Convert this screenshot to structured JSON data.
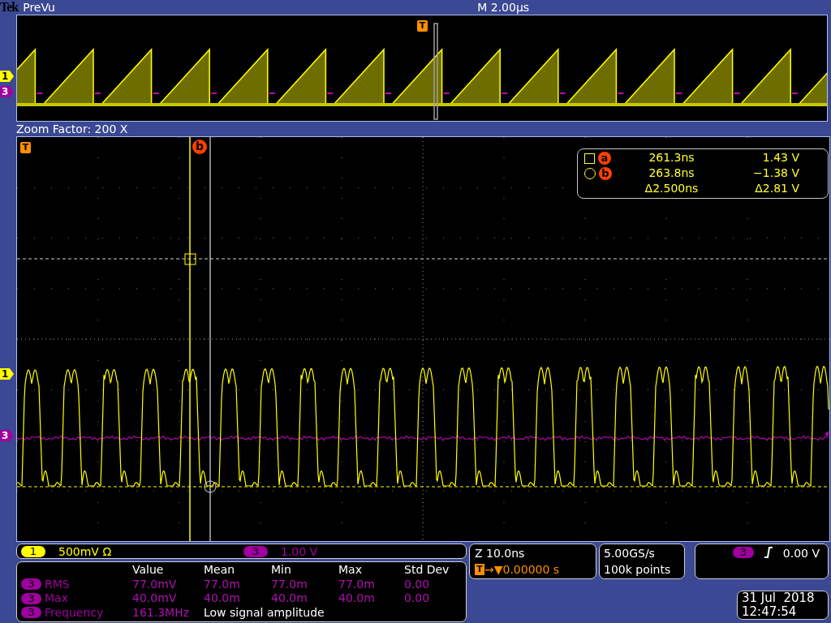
{
  "header": {
    "brand": "Tek",
    "mode": "PreVu",
    "timebase": "M 2.00µs"
  },
  "overview": {
    "trigger_marker": "T",
    "channel_markers": [
      {
        "label": "1",
        "color": "#ffff00"
      },
      {
        "label": "3",
        "color": "#a000a0"
      }
    ]
  },
  "zoom_bar": {
    "label": "Zoom Factor: 200 X"
  },
  "main": {
    "trigger_marker": "T",
    "cursor_marker": "b",
    "channel_markers": [
      {
        "label": "1",
        "color": "#ffff00"
      },
      {
        "label": "3",
        "color": "#a000a0"
      }
    ],
    "cursor_readout": [
      {
        "kind": "square",
        "cursor": "a",
        "time": "261.3ns",
        "volts": "1.43 V"
      },
      {
        "kind": "circle",
        "cursor": "b",
        "time": "263.8ns",
        "volts": "−1.38 V"
      },
      {
        "kind": "delta",
        "time": "Δ2.500ns",
        "volts": "Δ2.81 V"
      }
    ]
  },
  "channel_settings": [
    {
      "channel": "1",
      "scale": "500mV Ω",
      "color": "#ffff00"
    },
    {
      "channel": "3",
      "scale": "1.00 V",
      "color": "#a000a0"
    }
  ],
  "measurements": {
    "columns": [
      "Value",
      "Mean",
      "Min",
      "Max",
      "Std Dev"
    ],
    "rows": [
      {
        "channel": "3",
        "name": "RMS",
        "cells": [
          "77.0mV",
          "77.0m",
          "77.0m",
          "77.0m",
          "0.00"
        ]
      },
      {
        "channel": "3",
        "name": "Max",
        "cells": [
          "40.0mV",
          "40.0m",
          "40.0m",
          "40.0m",
          "0.00"
        ]
      },
      {
        "channel": "3",
        "name": "Frequency",
        "cells": [
          "161.3MHz"
        ],
        "note": "Low signal amplitude"
      }
    ]
  },
  "horizontal": {
    "zoom": "Z 10.0ns",
    "trigger_icon": "T",
    "position": "→▼0.00000 s"
  },
  "acquisition": {
    "sample_rate": "5.00GS/s",
    "record_length": "100k points"
  },
  "trigger": {
    "channel": "3",
    "level": "0.00 V"
  },
  "datetime": {
    "date": "31 Jul  2018",
    "time": "12:47:54"
  }
}
